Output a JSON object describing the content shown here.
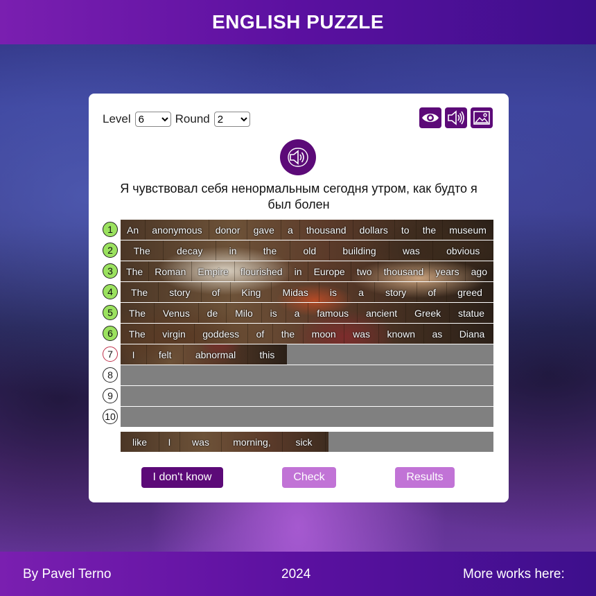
{
  "header": {
    "title": "ENGLISH PUZZLE"
  },
  "controls": {
    "level_label": "Level",
    "level_value": "6",
    "round_label": "Round",
    "round_value": "2",
    "icons": [
      "eye-icon",
      "speaker-icon",
      "image-icon"
    ]
  },
  "audio_hint": {
    "icon": "speaker-icon"
  },
  "translation": "Я чувствовал себя ненормальным сегодня утром, как будто я был болен",
  "rows": [
    {
      "number": "1",
      "state": "done",
      "words": [
        "An",
        "anonymous",
        "donor",
        "gave",
        "a",
        "thousand",
        "dollars",
        "to",
        "the",
        "museum"
      ]
    },
    {
      "number": "2",
      "state": "done",
      "words": [
        "The",
        "decay",
        "in",
        "the",
        "old",
        "building",
        "was",
        "obvious"
      ]
    },
    {
      "number": "3",
      "state": "done",
      "words": [
        "The",
        "Roman",
        "Empire",
        "flourished",
        "in",
        "Europe",
        "two",
        "thousand",
        "years",
        "ago"
      ]
    },
    {
      "number": "4",
      "state": "done",
      "words": [
        "The",
        "story",
        "of",
        "King",
        "Midas",
        "is",
        "a",
        "story",
        "of",
        "greed"
      ]
    },
    {
      "number": "5",
      "state": "done",
      "words": [
        "The",
        "Venus",
        "de",
        "Milo",
        "is",
        "a",
        "famous",
        "ancient",
        "Greek",
        "statue"
      ]
    },
    {
      "number": "6",
      "state": "done",
      "words": [
        "The",
        "virgin",
        "goddess",
        "of",
        "the",
        "moon",
        "was",
        "known",
        "as",
        "Diana"
      ]
    },
    {
      "number": "7",
      "state": "current",
      "words": [
        "I",
        "felt",
        "abnormal",
        "this"
      ]
    },
    {
      "number": "8",
      "state": "empty",
      "words": []
    },
    {
      "number": "9",
      "state": "empty",
      "words": []
    },
    {
      "number": "10",
      "state": "empty",
      "words": []
    }
  ],
  "word_bank": [
    "like",
    "I",
    "was",
    "morning,",
    "sick"
  ],
  "buttons": {
    "dont_know": "I don't know",
    "check": "Check",
    "results": "Results"
  },
  "footer": {
    "author": "By Pavel Terno",
    "year": "2024",
    "more": "More works here:"
  },
  "colors": {
    "accent": "#5c0a78",
    "accent_light": "#c173d6",
    "done_badge": "#9be25f",
    "current_badge_border": "#c0304a"
  }
}
